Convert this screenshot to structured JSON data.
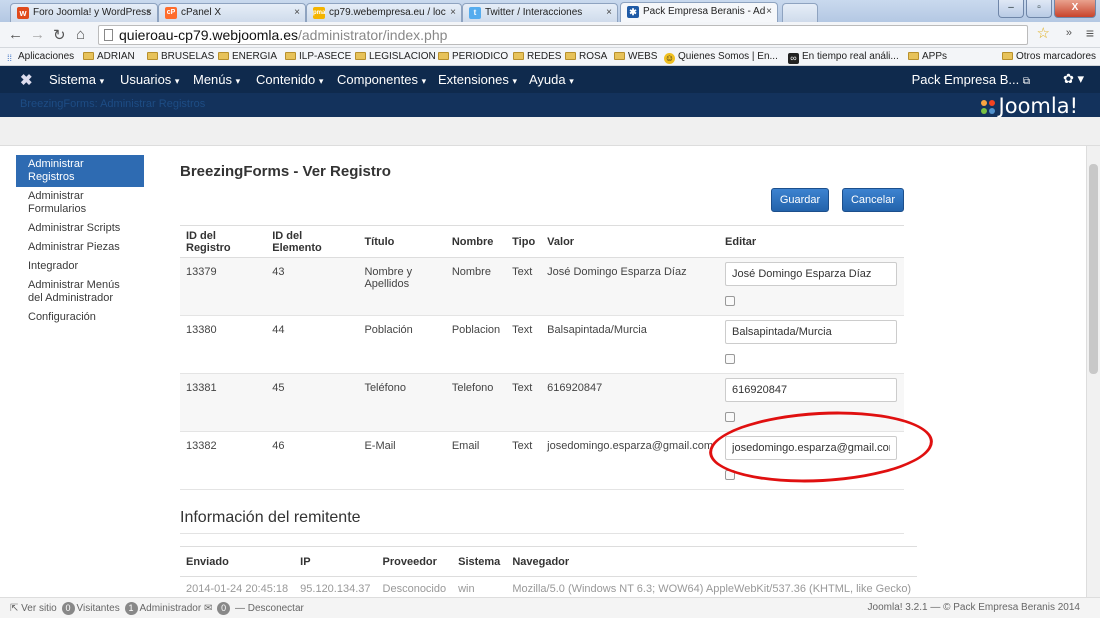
{
  "browser": {
    "tabs": [
      {
        "label": "Foro Joomla! y WordPress",
        "icon": "w",
        "color": "#e04a1b"
      },
      {
        "label": "cPanel X",
        "icon": "cP",
        "color": "#ff6c2c"
      },
      {
        "label": "cp79.webempresa.eu / loc",
        "icon": "pma",
        "color": "#f4b400"
      },
      {
        "label": "Twitter / Interacciones",
        "icon": "tw",
        "color": "#55acee"
      },
      {
        "label": "Pack Empresa Beranis - Ad",
        "icon": "joomla",
        "color": "#1e5aa6"
      }
    ],
    "url_host": "quieroau-cp79.webjoomla.es",
    "url_path": "/administrator/index.php",
    "bookmarks": [
      "Aplicaciones",
      "ADRIAN",
      "BRUSELAS",
      "ENERGIA",
      "ILP-ASECE",
      "LEGISLACION",
      "PERIODICO",
      "REDES",
      "ROSA",
      "WEBS",
      "Quienes Somos | En...",
      "En tiempo real análi...",
      "APPs",
      "Otros marcadores"
    ]
  },
  "joomla": {
    "menu": [
      "Sistema",
      "Usuarios",
      "Menús",
      "Contenido",
      "Componentes",
      "Extensiones",
      "Ayuda"
    ],
    "site_name": "Pack Empresa B...",
    "breadcrumb": "BreezingForms: Administrar Registros",
    "brand": "Joomla!"
  },
  "sidebar": {
    "items": [
      "Administrar Registros",
      "Administrar Formularios",
      "Administrar Scripts",
      "Administrar Piezas",
      "Integrador",
      "Administrar Menús del Administrador",
      "Configuración"
    ]
  },
  "main": {
    "title": "BreezingForms - Ver Registro",
    "save_label": "Guardar",
    "cancel_label": "Cancelar",
    "columns": [
      "ID del Registro",
      "ID del Elemento",
      "Título",
      "Nombre",
      "Tipo",
      "Valor",
      "Editar"
    ],
    "rows": [
      {
        "id": "13379",
        "element": "43",
        "title": "Nombre y Apellidos",
        "name": "Nombre",
        "type": "Text",
        "value": "José Domingo Esparza Díaz",
        "edit": "José Domingo Esparza Díaz"
      },
      {
        "id": "13380",
        "element": "44",
        "title": "Población",
        "name": "Poblacion",
        "type": "Text",
        "value": "Balsapintada/Murcia",
        "edit": "Balsapintada/Murcia"
      },
      {
        "id": "13381",
        "element": "45",
        "title": "Teléfono",
        "name": "Telefono",
        "type": "Text",
        "value": "616920847",
        "edit": "616920847"
      },
      {
        "id": "13382",
        "element": "46",
        "title": "E-Mail",
        "name": "Email",
        "type": "Text",
        "value": "josedomingo.esparza@gmail.com",
        "edit": "josedomingo.esparza@gmail.com"
      }
    ],
    "sender_title": "Información del remitente",
    "sender_columns": [
      "Enviado",
      "IP",
      "Proveedor",
      "Sistema",
      "Navegador"
    ],
    "sender_row": [
      "2014-01-24 20:45:18",
      "95.120.134.37",
      "Desconocido",
      "win",
      "Mozilla/5.0 (Windows NT 6.3; WOW64) AppleWebKit/537.36 (KHTML, like Gecko)"
    ]
  },
  "status": {
    "view_site": "Ver sitio",
    "visitors_count": "0",
    "visitors_label": "Visitantes",
    "admin_count": "1",
    "admin_label": "Administrador",
    "messages_count": "0",
    "logout": "Desconectar",
    "footer": "Joomla! 3.2.1 — © Pack Empresa Beranis 2014"
  }
}
